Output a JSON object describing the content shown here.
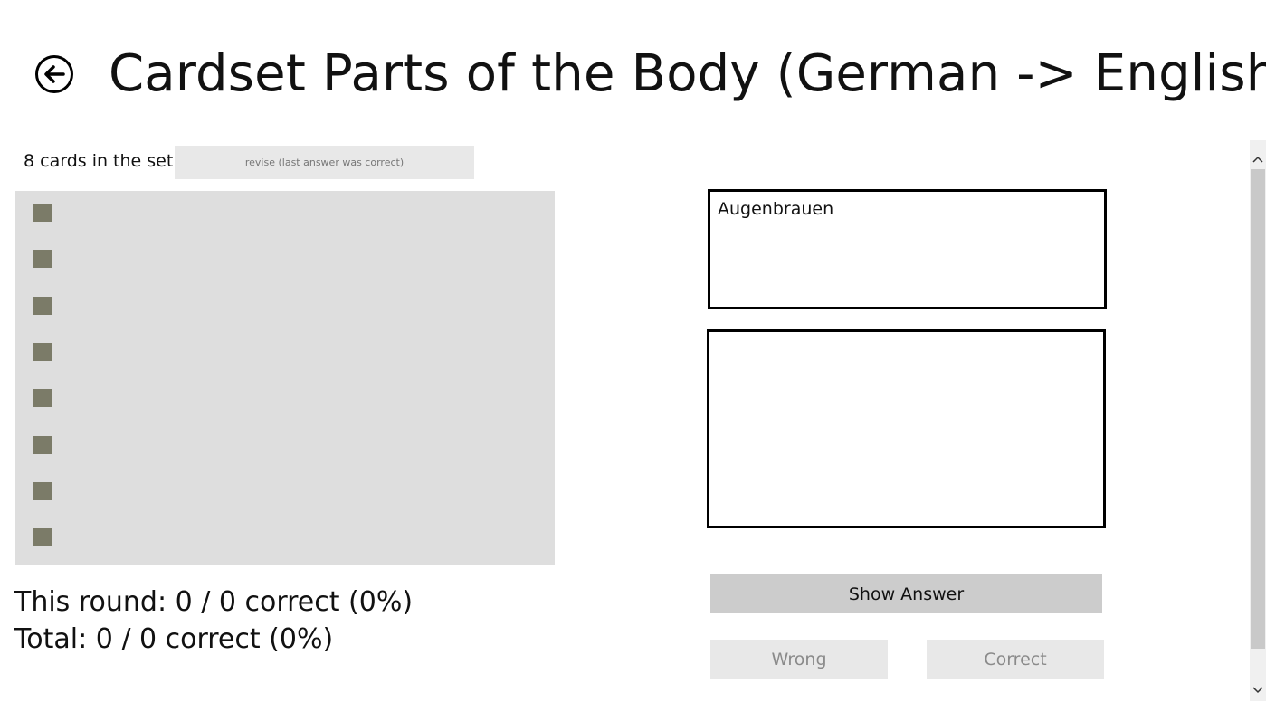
{
  "header": {
    "back_icon": "back-arrow-circle-icon",
    "title": "Cardset Parts of the Body (German -> English)"
  },
  "cardset": {
    "card_count_label": "8 cards in the set",
    "revise_label": "revise (last answer was correct)",
    "card_count": 8,
    "card_color": "#7b7b68"
  },
  "stats": {
    "round": "This round: 0 / 0 correct (0%)",
    "total": "Total: 0 / 0 correct (0%)"
  },
  "card": {
    "question": "Augenbrauen",
    "answer": ""
  },
  "actions": {
    "show_answer_label": "Show Answer",
    "wrong_label": "Wrong",
    "correct_label": "Correct"
  },
  "scrollbar": {
    "up_icon": "chevron-up-icon",
    "down_icon": "chevron-down-icon"
  },
  "colors": {
    "card_list_bg": "#dedede",
    "button_primary_bg": "#cccccc",
    "button_disabled_bg": "#e8e8e8"
  }
}
